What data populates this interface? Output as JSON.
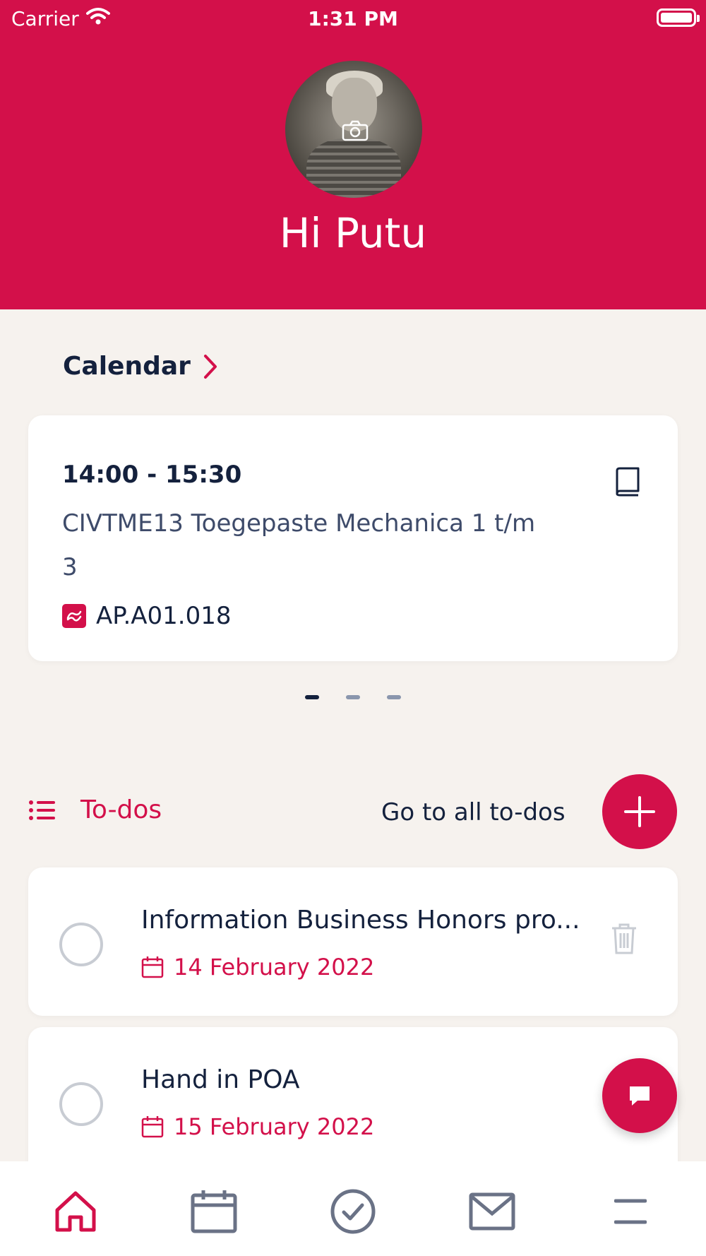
{
  "status_bar": {
    "carrier": "Carrier",
    "time": "1:31 PM"
  },
  "header": {
    "greeting": "Hi Putu"
  },
  "calendar": {
    "title": "Calendar",
    "event": {
      "time": "14:00 - 15:30",
      "course": "CIVTME13 Toegepaste Mechanica 1 t/m 3",
      "location": "AP.A01.018"
    },
    "pages": 3,
    "active_page": 1
  },
  "todos": {
    "title": "To-dos",
    "go_to_all": "Go to all to-dos",
    "items": [
      {
        "title": "Information Business Honors pro...",
        "date": "14 February 2022"
      },
      {
        "title": "Hand in POA",
        "date": "15 February 2022"
      }
    ]
  },
  "colors": {
    "accent": "#d3104a",
    "navy": "#14213d",
    "background": "#f6f2ee"
  },
  "bottom_nav": [
    "home-icon",
    "calendar-icon",
    "check-icon",
    "mail-icon",
    "menu-icon"
  ]
}
